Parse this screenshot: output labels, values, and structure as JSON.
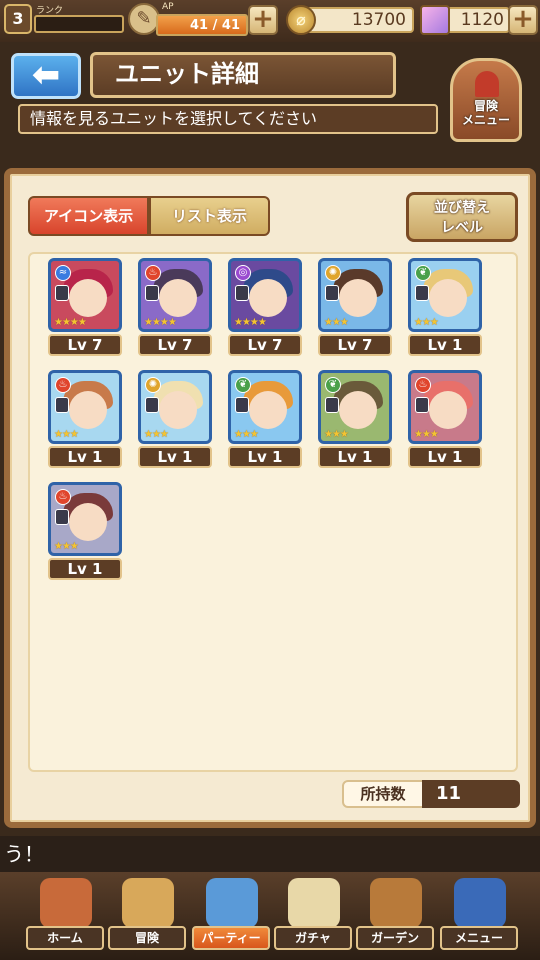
{
  "topbar": {
    "rank_value": "3",
    "rank_label": "ランク",
    "ap_label": "AP",
    "ap_text": "41 / 41",
    "ap_fill_fraction": 1.0,
    "coins": "13700",
    "gems": "1120",
    "plus_symbol": "+"
  },
  "header": {
    "back_arrow": "⬅",
    "title": "ユニット詳細",
    "subtitle": "情報を見るユニットを選択してください",
    "adventure_menu_label": "冒険\nメニュー"
  },
  "panel": {
    "tab_icon": "アイコン表示",
    "tab_list": "リスト表示",
    "sort_line1": "並び替え",
    "sort_line2": "レベル",
    "count_label": "所持数",
    "count_value": "11"
  },
  "units": [
    {
      "level": "Lv 7",
      "stars": "★★★★",
      "element": "wind",
      "element_color": "#3a7be0",
      "role_icon": "sword-icon",
      "bg": "#c94a5e",
      "hair": "#b8244a"
    },
    {
      "level": "Lv 7",
      "stars": "★★★★",
      "element": "fire",
      "element_color": "#e0452c",
      "role_icon": "sword-icon",
      "bg": "#8a6ac8",
      "hair": "#4a3a5a"
    },
    {
      "level": "Lv 7",
      "stars": "★★★★",
      "element": "dark",
      "element_color": "#9a4ad0",
      "role_icon": "sword-icon",
      "bg": "#6a4aa0",
      "hair": "#2e4a8a"
    },
    {
      "level": "Lv 7",
      "stars": "★★★",
      "element": "light",
      "element_color": "#e0a52c",
      "role_icon": "shield-icon",
      "bg": "#7ab8e8",
      "hair": "#5a3a2a"
    },
    {
      "level": "Lv 1",
      "stars": "★★★",
      "element": "earth",
      "element_color": "#4aa04a",
      "role_icon": "staff-icon",
      "bg": "#9ad0f0",
      "hair": "#e8c878"
    },
    {
      "level": "Lv 1",
      "stars": "★★★",
      "element": "fire",
      "element_color": "#e0452c",
      "role_icon": "staff-icon",
      "bg": "#a8d8f0",
      "hair": "#c87a4a"
    },
    {
      "level": "Lv 1",
      "stars": "★★★",
      "element": "light",
      "element_color": "#e0a52c",
      "role_icon": "staff-icon",
      "bg": "#a8d8f0",
      "hair": "#f0e0b0"
    },
    {
      "level": "Lv 1",
      "stars": "★★★",
      "element": "earth",
      "element_color": "#4aa04a",
      "role_icon": "bow-icon",
      "bg": "#8ac8f0",
      "hair": "#e89a3a"
    },
    {
      "level": "Lv 1",
      "stars": "★★★",
      "element": "earth",
      "element_color": "#4aa04a",
      "role_icon": "sword-icon",
      "bg": "#9ab870",
      "hair": "#6a5a3a"
    },
    {
      "level": "Lv 1",
      "stars": "★★★",
      "element": "fire",
      "element_color": "#e0452c",
      "role_icon": "sword-icon",
      "bg": "#c87a8a",
      "hair": "#e8706a"
    },
    {
      "level": "Lv 1",
      "stars": "★★★",
      "element": "fire",
      "element_color": "#e0452c",
      "role_icon": "shield-icon",
      "bg": "#a8a8c8",
      "hair": "#7a3a3a"
    }
  ],
  "message": "う！",
  "nav": [
    {
      "label": "ホーム",
      "icon": "home-icon",
      "color": "#c86a3a",
      "active": false
    },
    {
      "label": "冒険",
      "icon": "adventure-icon",
      "color": "#d8a85a",
      "active": false
    },
    {
      "label": "パーティー",
      "icon": "chess-icon",
      "color": "#5a9ad8",
      "active": true
    },
    {
      "label": "ガチャ",
      "icon": "gacha-icon",
      "color": "#e8d8a8",
      "active": false
    },
    {
      "label": "ガーデン",
      "icon": "garden-icon",
      "color": "#b87a3a",
      "active": false
    },
    {
      "label": "メニュー",
      "icon": "book-icon",
      "color": "#3a6ab8",
      "active": false
    }
  ]
}
